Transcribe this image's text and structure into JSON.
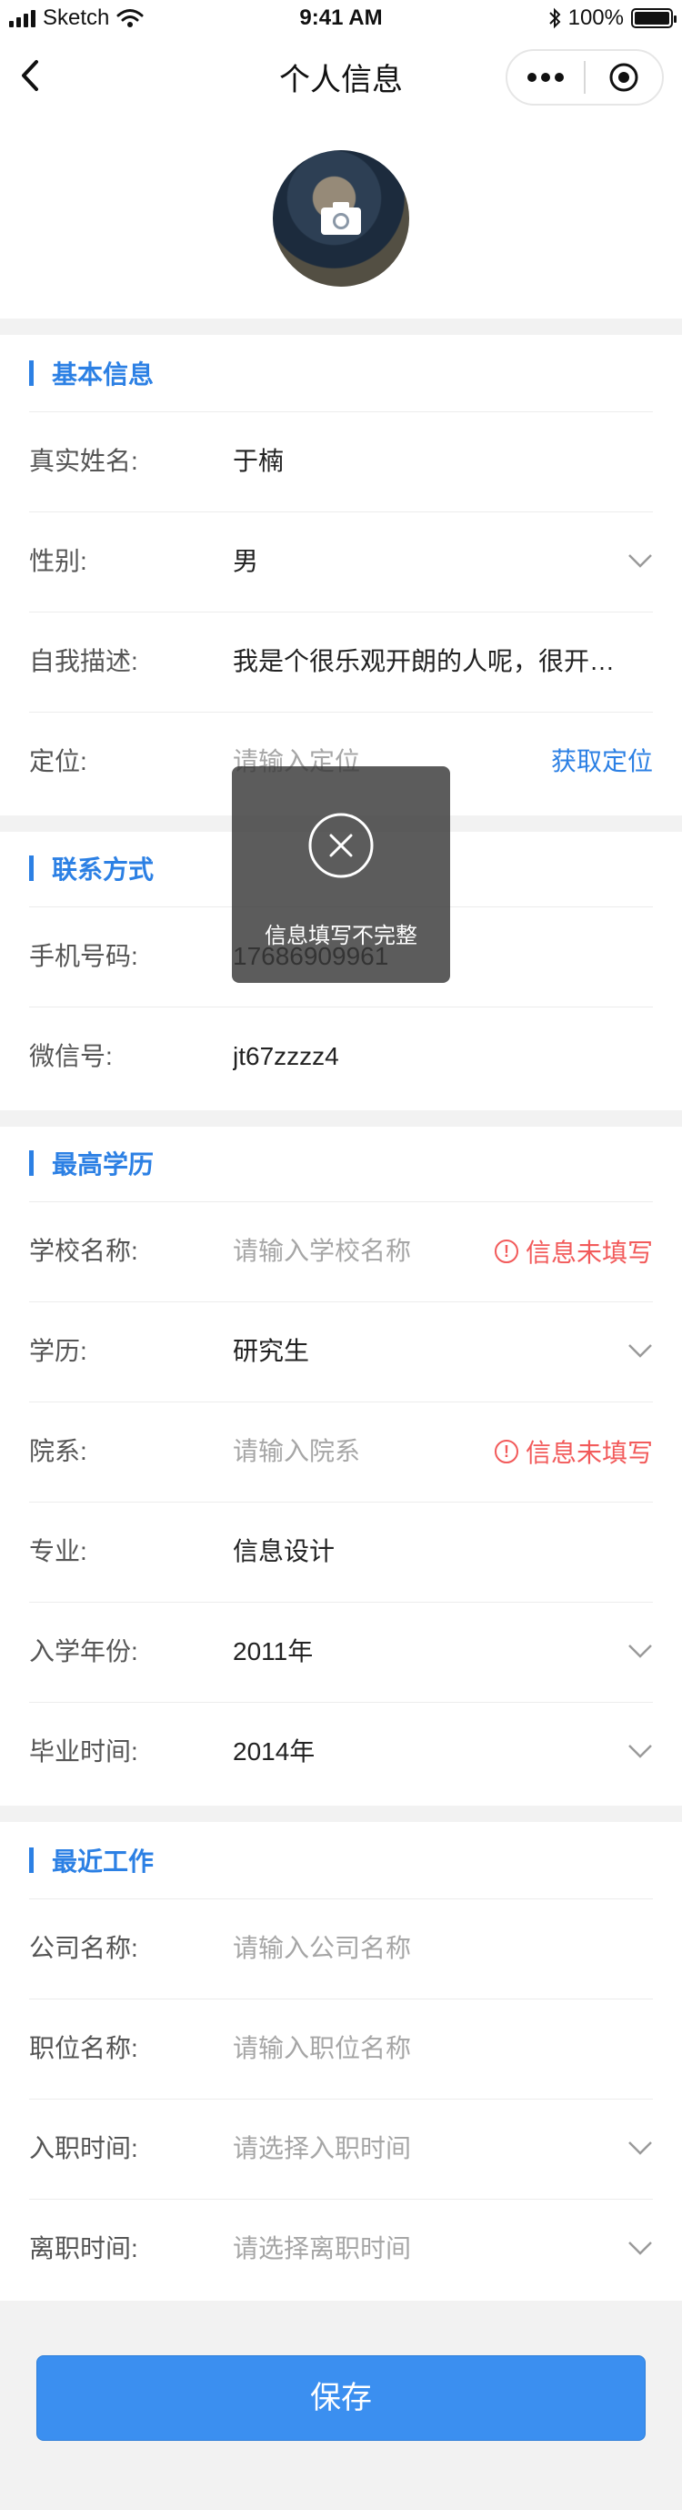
{
  "status_bar": {
    "carrier": "Sketch",
    "time": "9:41 AM",
    "battery": "100%"
  },
  "nav": {
    "title": "个人信息"
  },
  "toast": {
    "message": "信息填写不完整"
  },
  "sections": {
    "basic": {
      "title": "基本信息",
      "name": {
        "label": "真实姓名:",
        "value": "于楠"
      },
      "gender": {
        "label": "性别:",
        "value": "男"
      },
      "description": {
        "label": "自我描述:",
        "value": "我是个很乐观开朗的人呢，很开…"
      },
      "location": {
        "label": "定位:",
        "placeholder": "请输入定位",
        "action": "获取定位"
      }
    },
    "contact": {
      "title": "联系方式",
      "phone": {
        "label": "手机号码:",
        "value": "17686909961"
      },
      "wechat": {
        "label": "微信号:",
        "value": "jt67zzzz4"
      }
    },
    "education": {
      "title": "最高学历",
      "school": {
        "label": "学校名称:",
        "placeholder": "请输入学校名称",
        "error": "信息未填写"
      },
      "degree": {
        "label": "学历:",
        "value": "研究生"
      },
      "department": {
        "label": "院系:",
        "placeholder": "请输入院系",
        "error": "信息未填写"
      },
      "major": {
        "label": "专业:",
        "value": "信息设计"
      },
      "enroll_year": {
        "label": "入学年份:",
        "value": "2011年"
      },
      "graduate_year": {
        "label": "毕业时间:",
        "value": "2014年"
      }
    },
    "work": {
      "title": "最近工作",
      "company": {
        "label": "公司名称:",
        "placeholder": "请输入公司名称"
      },
      "position": {
        "label": "职位名称:",
        "placeholder": "请输入职位名称"
      },
      "start": {
        "label": "入职时间:",
        "placeholder": "请选择入职时间"
      },
      "end": {
        "label": "离职时间:",
        "placeholder": "请选择离职时间"
      }
    }
  },
  "save_button": {
    "label": "保存"
  },
  "colors": {
    "accent": "#2c80e4",
    "error": "#f25a5a",
    "button": "#3b8ff0",
    "background_gap": "#f2f2f2"
  }
}
